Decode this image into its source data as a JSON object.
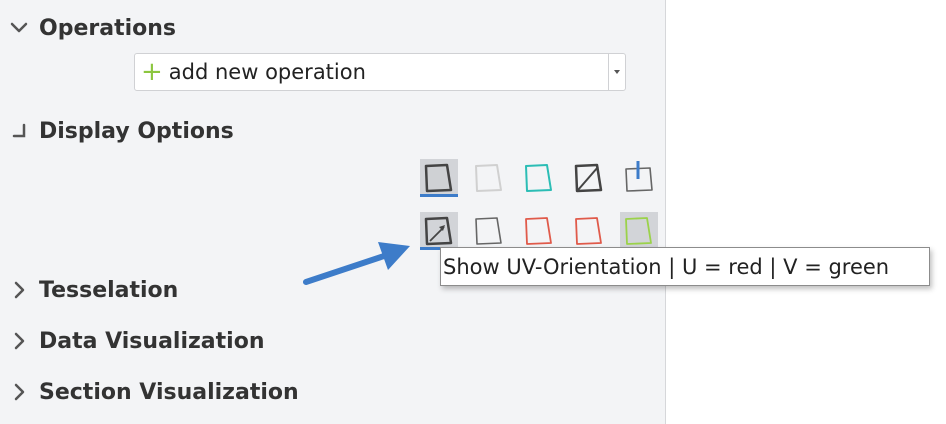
{
  "panel": {
    "operations": {
      "title": "Operations",
      "add_label": "add new operation"
    },
    "display_options": {
      "title": "Display Options",
      "row1": [
        {
          "icon": "shaded-surface-icon",
          "active": true
        },
        {
          "icon": "transparent-surface-icon",
          "active": false
        },
        {
          "icon": "teal-edges-icon",
          "active": false
        },
        {
          "icon": "triangulated-surface-icon",
          "active": false
        },
        {
          "icon": "surface-normals-icon",
          "active": false
        }
      ],
      "row2": [
        {
          "icon": "uv-orientation-icon",
          "active": true
        },
        {
          "icon": "gray-outline-icon",
          "active": false
        },
        {
          "icon": "red-outline-icon",
          "active": false
        },
        {
          "icon": "red-outline-icon-2",
          "active": false
        },
        {
          "icon": "green-outline-icon",
          "active": true
        }
      ]
    },
    "tesselation": {
      "title": "Tesselation"
    },
    "data_visualization": {
      "title": "Data Visualization"
    },
    "section_visualization": {
      "title": "Section Visualization"
    }
  },
  "tooltip": {
    "text": "Show UV-Orientation | U = red | V = green"
  },
  "colors": {
    "accent": "#3d7cc9",
    "plus": "#8cc63f",
    "panel_bg": "#f3f4f6",
    "teal": "#2bbdb5",
    "red": "#e05a4a",
    "green": "#9bd24a"
  }
}
